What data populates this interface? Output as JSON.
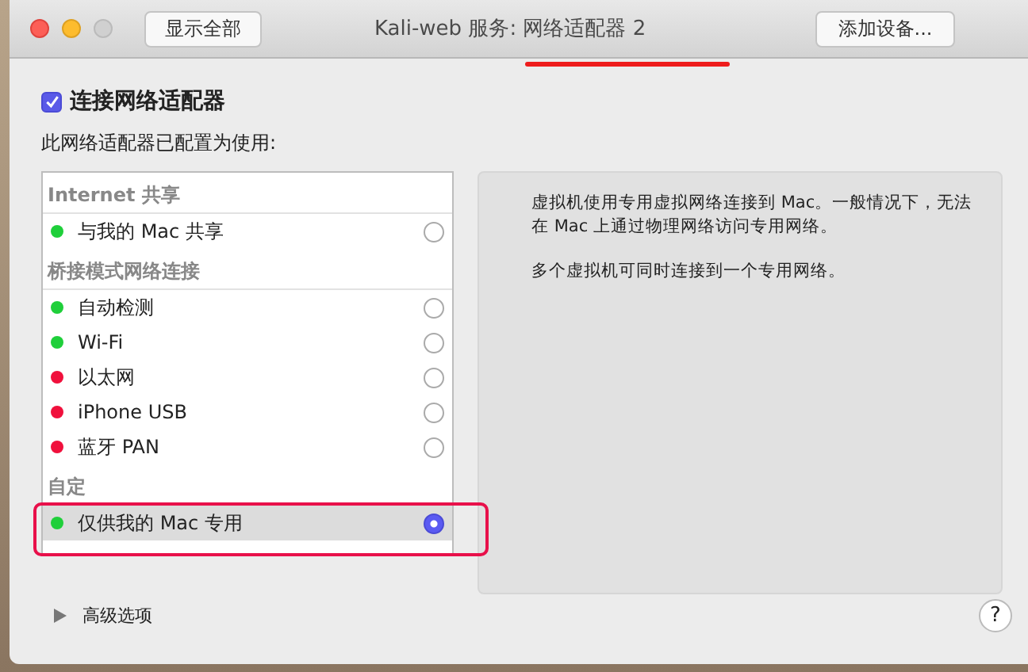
{
  "window": {
    "title": "Kali-web 服务: 网络适配器 2"
  },
  "toolbar": {
    "show_all_button": "显示全部",
    "add_device_button": "添加设备..."
  },
  "connect": {
    "label": "连接网络适配器",
    "checked": true
  },
  "subtitle": "此网络适配器已配置为使用:",
  "sections": [
    {
      "heading": "Internet 共享",
      "items": [
        {
          "label": "与我的 Mac 共享",
          "color": "#1fcf3a",
          "selected": false
        }
      ]
    },
    {
      "heading": "桥接模式网络连接",
      "items": [
        {
          "label": "自动检测",
          "color": "#1fcf3a",
          "selected": false
        },
        {
          "label": "Wi-Fi",
          "color": "#1fcf3a",
          "selected": false
        },
        {
          "label": "以太网",
          "color": "#f0103c",
          "selected": false
        },
        {
          "label": "iPhone USB",
          "color": "#f0103c",
          "selected": false
        },
        {
          "label": "蓝牙 PAN",
          "color": "#f0103c",
          "selected": false
        }
      ]
    },
    {
      "heading": "自定",
      "items": [
        {
          "label": "仅供我的 Mac 专用",
          "color": "#1fcf3a",
          "selected": true
        }
      ]
    }
  ],
  "description": [
    "虚拟机使用专用虚拟网络连接到 Mac。一般情况下，无法在 Mac 上通过物理网络访问专用网络。",
    "多个虚拟机可同时连接到一个专用网络。"
  ],
  "advanced": {
    "label": "高级选项",
    "expanded": false
  },
  "help_button": "?"
}
